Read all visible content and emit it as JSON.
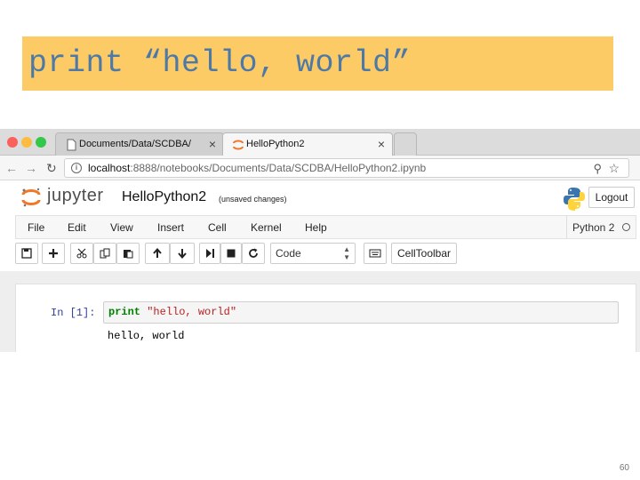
{
  "slide": {
    "title": "print “hello, world”",
    "title_bg": "#fccb66",
    "title_color": "#4d79a6",
    "page_number": "60"
  },
  "browser": {
    "tabs": [
      {
        "label": "Documents/Data/SCDBA/",
        "icon": "folder-page-icon",
        "active": false
      },
      {
        "label": "HelloPython2",
        "icon": "jupyter-tab-icon",
        "active": true
      }
    ],
    "url_host": "localhost",
    "url_rest": ":8888/notebooks/Documents/Data/SCDBA/HelloPython2.ipynb"
  },
  "jupyter": {
    "brand": "jupyter",
    "notebook_title": "HelloPython2",
    "save_status": "(unsaved changes)",
    "logout_label": "Logout",
    "menu": [
      "File",
      "Edit",
      "View",
      "Insert",
      "Cell",
      "Kernel",
      "Help"
    ],
    "kernel_name": "Python 2",
    "toolbar": {
      "cell_type": "Code",
      "celltoolbar_label": "CellToolbar",
      "icons": [
        "save-icon",
        "add-cell-icon",
        "cut-icon",
        "copy-icon",
        "paste-icon",
        "move-up-icon",
        "move-down-icon",
        "run-icon",
        "stop-icon",
        "restart-icon",
        "keyboard-icon"
      ]
    },
    "cell": {
      "prompt": "In [1]:",
      "code_keyword": "print",
      "code_string": "\"hello, world\"",
      "output": "hello, world"
    }
  }
}
